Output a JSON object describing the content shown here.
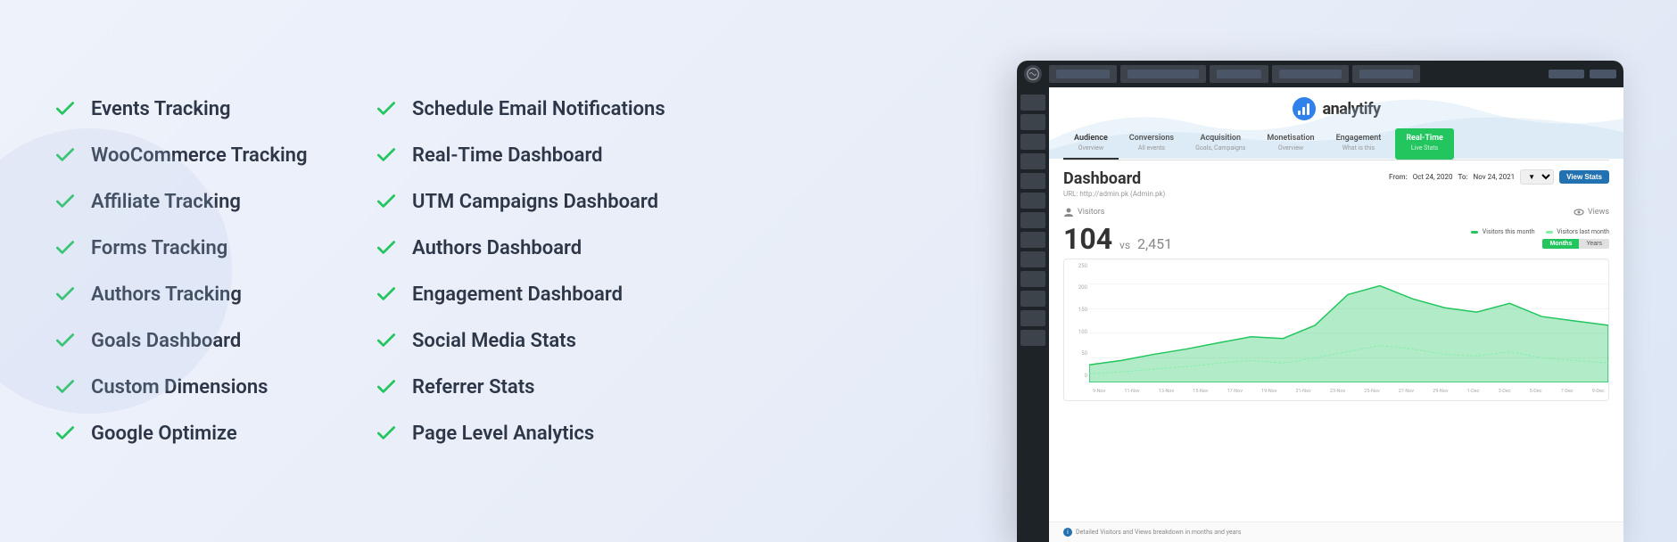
{
  "background": {
    "color": "#e8eef8"
  },
  "features": {
    "column1": [
      {
        "id": "events-tracking",
        "label": "Events Tracking"
      },
      {
        "id": "woocommerce-tracking",
        "label": "WooCommerce Tracking"
      },
      {
        "id": "affiliate-tracking",
        "label": "Affiliate Tracking"
      },
      {
        "id": "forms-tracking",
        "label": "Forms Tracking"
      },
      {
        "id": "authors-tracking",
        "label": "Authors Tracking"
      },
      {
        "id": "goals-dashboard",
        "label": "Goals Dashboard"
      },
      {
        "id": "custom-dimensions",
        "label": "Custom Dimensions"
      },
      {
        "id": "google-optimize",
        "label": "Google Optimize"
      }
    ],
    "column2": [
      {
        "id": "schedule-email",
        "label": "Schedule Email Notifications"
      },
      {
        "id": "realtime-dashboard",
        "label": "Real-Time Dashboard"
      },
      {
        "id": "utm-campaigns",
        "label": "UTM Campaigns Dashboard"
      },
      {
        "id": "authors-dashboard",
        "label": "Authors Dashboard"
      },
      {
        "id": "engagement-dashboard",
        "label": "Engagement Dashboard"
      },
      {
        "id": "social-media-stats",
        "label": "Social Media Stats"
      },
      {
        "id": "referrer-stats",
        "label": "Referrer Stats"
      },
      {
        "id": "page-level-analytics",
        "label": "Page Level Analytics"
      }
    ]
  },
  "dashboard": {
    "logo_text": "analytify",
    "tabs": [
      {
        "label": "Audience",
        "sub": "Overview",
        "active": true
      },
      {
        "label": "Conversions",
        "sub": "All events",
        "active": false
      },
      {
        "label": "Acquisition",
        "sub": "Goals, Campaigns",
        "active": false
      },
      {
        "label": "Monetisation",
        "sub": "Overview",
        "active": false
      },
      {
        "label": "Engagement",
        "sub": "What is this",
        "active": false
      },
      {
        "label": "Real-Time",
        "sub": "Live Stats",
        "active": false,
        "highlight": true
      }
    ],
    "title": "Dashboard",
    "url": "URL: http://admin.pk (Admin.pk)",
    "date_from_label": "From:",
    "date_from": "Oct 24, 2020",
    "date_to_label": "To:",
    "date_to": "Nov 24, 2021",
    "view_stats_label": "View Stats",
    "visitors_label": "Visitors",
    "views_label": "Views",
    "visitors_count": "104",
    "visitors_vs": "vs",
    "visitors_compare": "2,451",
    "month_btn": "Months",
    "year_btn": "Years",
    "legend_this_month": "Visitors this month",
    "legend_last_month": "Visitors last month",
    "y_labels": [
      "250",
      "200",
      "150",
      "100",
      "50",
      "0"
    ],
    "x_labels": [
      "9-Nov",
      "11-Nov",
      "13-Nov",
      "15-Nov",
      "17-Nov",
      "19-Nov",
      "21-Nov",
      "23-Nov",
      "25-Nov",
      "27-Nov",
      "29-Nov",
      "1-Dec",
      "3-Dec",
      "5-Dec",
      "7-Dec",
      "9-Dec"
    ],
    "footer_text": "Detailed Visitors and Views breakdown in months and years"
  },
  "check_color": "#22c55e"
}
